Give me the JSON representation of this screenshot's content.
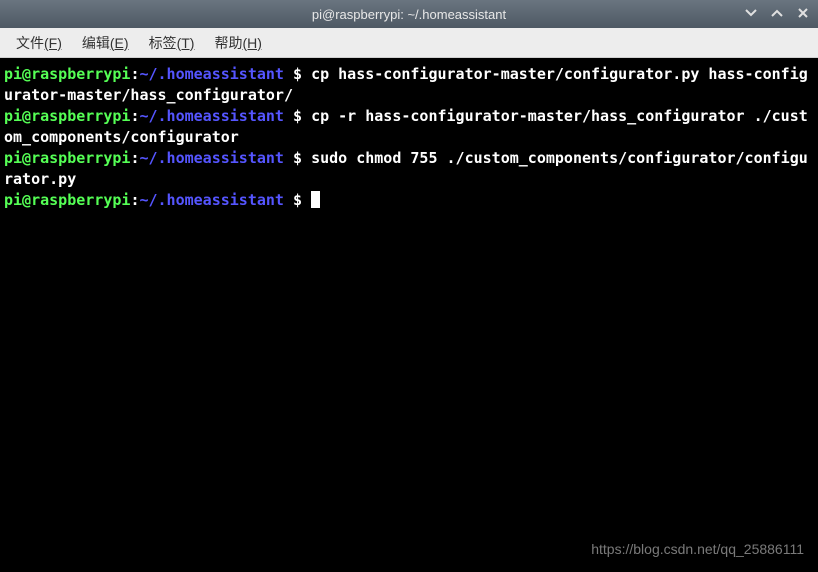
{
  "window": {
    "title": "pi@raspberrypi: ~/.homeassistant"
  },
  "menu": {
    "file": {
      "text": "文件",
      "accel": "(F)"
    },
    "edit": {
      "text": "编辑",
      "accel": "(E)"
    },
    "tabs": {
      "text": "标签",
      "accel": "(T)"
    },
    "help": {
      "text": "帮助",
      "accel": "(H)"
    }
  },
  "prompt": {
    "user": "pi@raspberrypi",
    "colon": ":",
    "path": "~/.homeassistant",
    "dollar": " $ "
  },
  "lines": {
    "cmd1": "cp hass-configurator-master/configurator.py hass-configurator-master/hass_configurator/",
    "cmd2": "cp -r hass-configurator-master/hass_configurator ./custom_components/configurator",
    "cmd3": "sudo chmod 755 ./custom_components/configurator/configurator.py"
  },
  "watermark": "https://blog.csdn.net/qq_25886111"
}
